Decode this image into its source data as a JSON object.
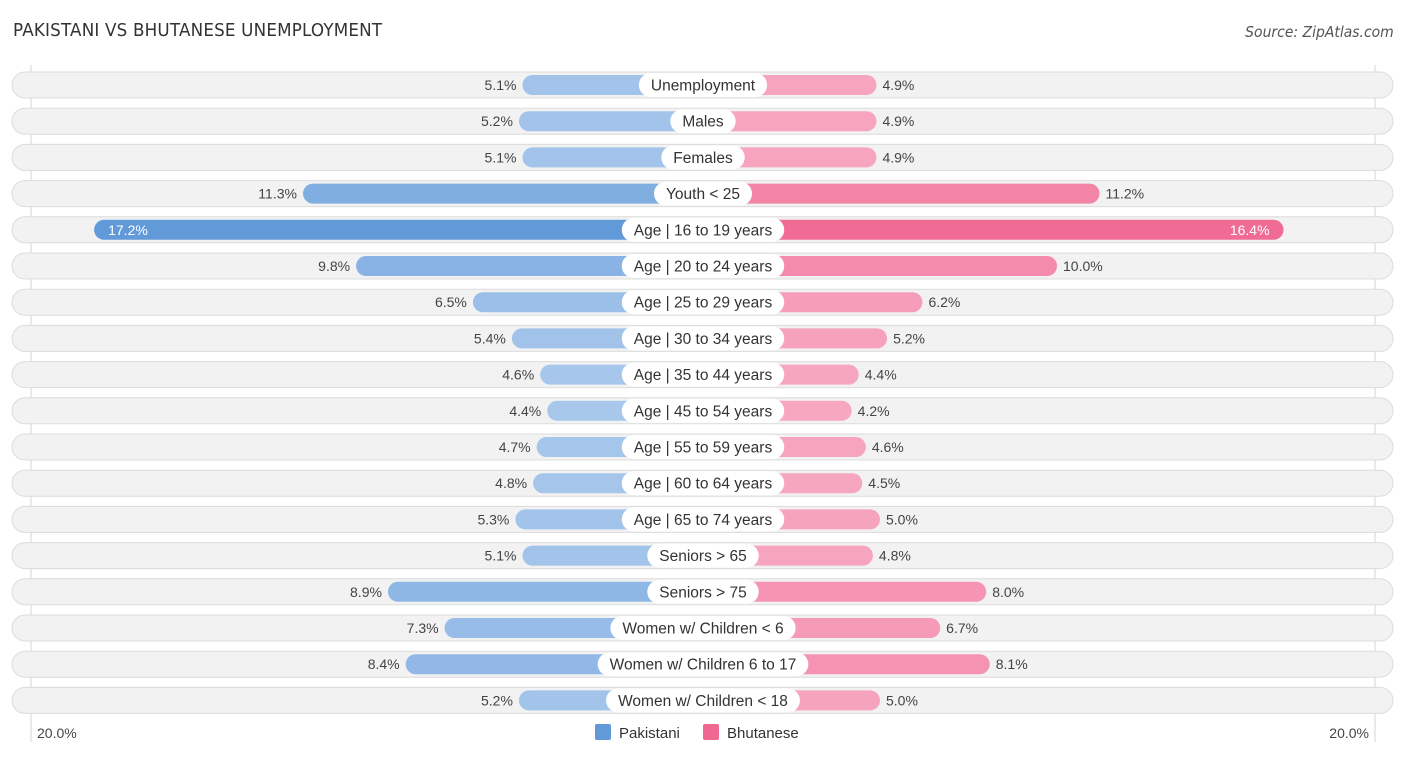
{
  "header": {
    "title": "PAKISTANI VS BHUTANESE UNEMPLOYMENT",
    "source": "Source: ZipAtlas.com"
  },
  "colors": {
    "pakistani_strong": "#6199d9",
    "pakistani_light": "#a9c8ec",
    "bhutanese_strong": "#f06892",
    "bhutanese_light": "#f7a8c1"
  },
  "chart_data": {
    "type": "bar",
    "orientation": "horizontal-diverging",
    "title": "PAKISTANI VS BHUTANESE UNEMPLOYMENT",
    "categories": [
      "Unemployment",
      "Males",
      "Females",
      "Youth < 25",
      "Age | 16 to 19 years",
      "Age | 20 to 24 years",
      "Age | 25 to 29 years",
      "Age | 30 to 34 years",
      "Age | 35 to 44 years",
      "Age | 45 to 54 years",
      "Age | 55 to 59 years",
      "Age | 60 to 64 years",
      "Age | 65 to 74 years",
      "Seniors > 65",
      "Seniors > 75",
      "Women w/ Children < 6",
      "Women w/ Children 6 to 17",
      "Women w/ Children < 18"
    ],
    "series": [
      {
        "name": "Pakistani",
        "side": "left",
        "values": [
          5.1,
          5.2,
          5.1,
          11.3,
          17.2,
          9.8,
          6.5,
          5.4,
          4.6,
          4.4,
          4.7,
          4.8,
          5.3,
          5.1,
          8.9,
          7.3,
          8.4,
          5.2
        ],
        "labels": [
          "5.1%",
          "5.2%",
          "5.1%",
          "11.3%",
          "17.2%",
          "9.8%",
          "6.5%",
          "5.4%",
          "4.6%",
          "4.4%",
          "4.7%",
          "4.8%",
          "5.3%",
          "5.1%",
          "8.9%",
          "7.3%",
          "8.4%",
          "5.2%"
        ]
      },
      {
        "name": "Bhutanese",
        "side": "right",
        "values": [
          4.9,
          4.9,
          4.9,
          11.2,
          16.4,
          10.0,
          6.2,
          5.2,
          4.4,
          4.2,
          4.6,
          4.5,
          5.0,
          4.8,
          8.0,
          6.7,
          8.1,
          5.0
        ],
        "labels": [
          "4.9%",
          "4.9%",
          "4.9%",
          "11.2%",
          "16.4%",
          "10.0%",
          "6.2%",
          "5.2%",
          "4.4%",
          "4.2%",
          "4.6%",
          "4.5%",
          "5.0%",
          "4.8%",
          "8.0%",
          "6.7%",
          "8.1%",
          "5.0%"
        ]
      }
    ],
    "xlim": [
      0,
      20
    ],
    "axis_labels": {
      "left": "20.0%",
      "right": "20.0%"
    },
    "legend": {
      "position": "bottom-center",
      "entries": [
        "Pakistani",
        "Bhutanese"
      ]
    },
    "xlabel": "",
    "ylabel": "",
    "grid": false
  }
}
